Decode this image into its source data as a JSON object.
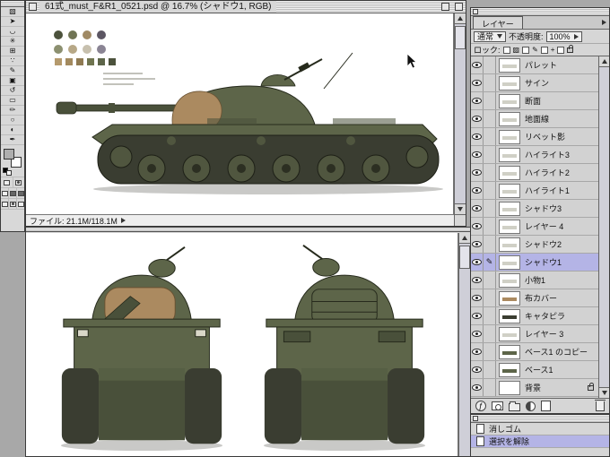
{
  "title_bar": {
    "title": "61式_must_F&R1_0521.psd @ 16.7% (シャドウ1, RGB)"
  },
  "doc1": {
    "status": "ファイル: 21.1M/118.1M"
  },
  "toolbar": {
    "tools": [
      {
        "name": "rectangular-marquee",
        "glyph": "▧"
      },
      {
        "name": "move",
        "glyph": "➤"
      },
      {
        "name": "lasso",
        "glyph": "◡"
      },
      {
        "name": "magic-wand",
        "glyph": "✳"
      },
      {
        "name": "crop",
        "glyph": "⊞"
      },
      {
        "name": "airbrush",
        "glyph": "∵"
      },
      {
        "name": "paintbrush",
        "glyph": "✎"
      },
      {
        "name": "clone-stamp",
        "glyph": "▣"
      },
      {
        "name": "history-brush",
        "glyph": "↺"
      },
      {
        "name": "eraser",
        "glyph": "▭"
      },
      {
        "name": "pencil",
        "glyph": "✏"
      },
      {
        "name": "blur",
        "glyph": "○"
      },
      {
        "name": "dodge",
        "glyph": "◐"
      },
      {
        "name": "pen",
        "glyph": "✒"
      }
    ]
  },
  "layers_panel": {
    "tab": "レイヤー",
    "blend_mode": "通常",
    "opacity_label": "不透明度:",
    "opacity_value": "100%",
    "lock_label": "ロック:",
    "lock_icons": [
      "▨",
      "✎",
      "+"
    ],
    "active_indicator": "✎",
    "effects_glyph": "ƒ",
    "selected_layer": "シャドウ1",
    "layers": [
      {
        "name": "パレット",
        "visible": true
      },
      {
        "name": "サイン",
        "visible": true
      },
      {
        "name": "断面",
        "visible": true
      },
      {
        "name": "地面線",
        "visible": true
      },
      {
        "name": "リベット影",
        "visible": true
      },
      {
        "name": "ハイライト3",
        "visible": true
      },
      {
        "name": "ハイライト2",
        "visible": true
      },
      {
        "name": "ハイライト1",
        "visible": true
      },
      {
        "name": "シャドウ3",
        "visible": true
      },
      {
        "name": "レイヤー 4",
        "visible": true
      },
      {
        "name": "シャドウ2",
        "visible": true
      },
      {
        "name": "シャドウ1",
        "visible": true,
        "active": true
      },
      {
        "name": "小物1",
        "visible": true
      },
      {
        "name": "布カバー",
        "visible": true
      },
      {
        "name": "キャタピラ",
        "visible": true
      },
      {
        "name": "レイヤー 3",
        "visible": true
      },
      {
        "name": "ベース1 のコピー",
        "visible": true
      },
      {
        "name": "ベース1",
        "visible": true
      },
      {
        "name": "背景",
        "visible": true,
        "locked": true
      }
    ]
  },
  "history_panel": {
    "items": [
      "消しゴム",
      "選択を解除"
    ],
    "selected": "選択を解除"
  },
  "canvas1": {
    "dots": [
      "#4c523c",
      "#707454",
      "#a08a64",
      "#5c5663",
      "#8c9070",
      "#b7a887",
      "#c7c0ae",
      "#8a8494"
    ],
    "swatches": [
      "#b59a6d",
      "#a38a5f",
      "#8f7a52",
      "#6f744f",
      "#5d6549",
      "#4c523c"
    ]
  },
  "colors": {
    "tank_olive": "#5d6549",
    "tank_olive_dark": "#49503a",
    "tank_track": "#3a3d31",
    "tank_wheel": "#50563f",
    "tank_cloth": "#ab8a60",
    "selection_highlight": "#b4b4e6",
    "foreground_swatch": "#aeaeae",
    "background_swatch": "#ffffff"
  }
}
